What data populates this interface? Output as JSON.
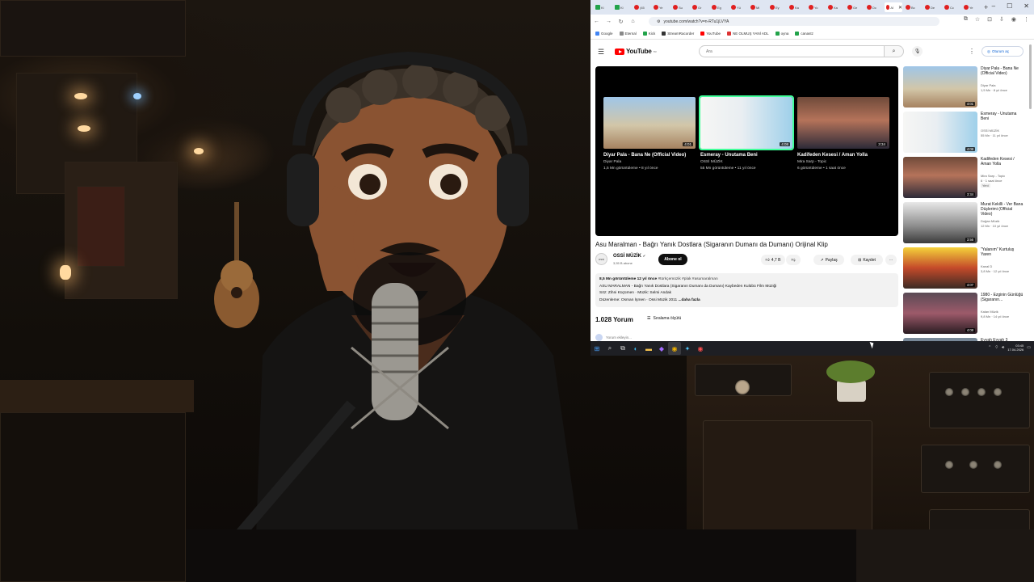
{
  "browser": {
    "tabs": [
      {
        "label": "Ki",
        "favicon": "green"
      },
      {
        "label": "Ki",
        "favicon": "green"
      },
      {
        "label": "(45",
        "favicon": "red"
      },
      {
        "label": "Ye",
        "favicon": "red"
      },
      {
        "label": "Su",
        "favicon": "red"
      },
      {
        "label": "Gr",
        "favicon": "red"
      },
      {
        "label": "Eg",
        "favicon": "red"
      },
      {
        "label": "Yü",
        "favicon": "red"
      },
      {
        "label": "Mi",
        "favicon": "red"
      },
      {
        "label": "Ey",
        "favicon": "red"
      },
      {
        "label": "Ka",
        "favicon": "red"
      },
      {
        "label": "Yo",
        "favicon": "red"
      },
      {
        "label": "Ka",
        "favicon": "red"
      },
      {
        "label": "Ge",
        "favicon": "red"
      },
      {
        "label": "Dc",
        "favicon": "red"
      },
      {
        "label": "Aİ",
        "favicon": "red",
        "active": true
      },
      {
        "label": "Bc",
        "favicon": "red"
      },
      {
        "label": "De",
        "favicon": "red"
      },
      {
        "label": "Cc",
        "favicon": "red"
      },
      {
        "label": "Ye",
        "favicon": "red"
      }
    ],
    "url": "youtube.com/watch?v=n-RTu1jLVYA",
    "bookmarks": [
      "Google",
      "Eternal",
      "Kick",
      "StreamRacorder",
      "YouTube",
      "NE OLMUŞ YANİ ADL",
      "oyna",
      "canastz"
    ]
  },
  "youtube": {
    "logo_text": "YouTube",
    "logo_country": "TR",
    "search_placeholder": "Ara",
    "sign_in_label": "Oturum aç",
    "end_screen": [
      {
        "title": "Diyar Pala - Bana Ne (Official Video)",
        "channel": "Diyar Pala",
        "stats": "1,5 Mn görüntüleme • 8 yıl önce",
        "duration": "4:01"
      },
      {
        "title": "Esmeray - Unutama Beni",
        "channel": "OSSİ MÜZİK",
        "stats": "55 Mn görüntüleme • 11 yıl önce",
        "duration": "4:08"
      },
      {
        "title": "Kadifeden Kesesi / Aman Yolla",
        "channel": "Mira Sarp - Topic",
        "stats": "6 görüntüleme • 1 saat önce",
        "duration": "3:34"
      }
    ],
    "video_title": "Asu Maralman - Bağrı Yanık Dostlara (Sigaranın Dumanı da Dumanı) Orijinal Klip",
    "channel": {
      "name": "OSSİ MÜZİK",
      "subs": "3,55 B abone",
      "avatar_text": "OSSİ"
    },
    "subscribe_label": "Abone ol",
    "likes": "4,7 B",
    "share_label": "Paylaş",
    "save_label": "Kaydet",
    "description": {
      "stats": "8,5 Mn görüntüleme  12 yıl önce",
      "tags": "#türkçemüzik #plak #asumaralman",
      "line1": "ASU MARALMAN - Bağrı Yanık Dostlara (Sigaranın Dumanı da Dumanı) Kaybeden Kulübü Film Müziği",
      "line2": "Söz: Zihni Küçümen · Müzik: Selmi Andak",
      "line3": "Düzenleme: Osman İşmen · Ossi Müzik 2011",
      "more": "...daha fazla"
    },
    "comments_count": "1.028 Yorum",
    "sort_label": "Sıralama ölçütü",
    "add_comment": "Yorum ekleyin...",
    "sidebar": [
      {
        "title": "Diyar Pala - Bana Ne (Official Video)",
        "channel": "Diyar Pala",
        "stats": "1,5 Mn · 8 yıl önce",
        "duration": "4:01"
      },
      {
        "title": "Esmeray - Unutama Beni",
        "channel": "OSSİ MÜZİK",
        "stats": "55 Mn · 11 yıl önce",
        "duration": "4:08"
      },
      {
        "title": "Kadifeden Kesesi / Aman Yolla",
        "channel": "Mira Sarp - Topic",
        "stats": "6 · 1 saat önce",
        "badge": "Yeni",
        "duration": "3:34"
      },
      {
        "title": "Murat Kekilli - Ver Bana Düşlerimi (Official Video)",
        "channel": "Doğan Müzik",
        "stats": "12 Mn · 10 yıl önce",
        "duration": "3:56"
      },
      {
        "title": "\"Yalanım\" Kurtuluş Yaren",
        "channel": "Kanal D",
        "stats": "3,8 Mn · 12 yıl önce",
        "duration": "4:07"
      },
      {
        "title": "1980 - Ezginin Günlüğü (Sigaranın...",
        "channel": "Kalan Müzik",
        "stats": "9,8 Mn · 14 yıl önce",
        "duration": "4:08"
      },
      {
        "title": "Eyvah Eyvah 3",
        "channel": "",
        "stats": "",
        "duration": ""
      }
    ]
  },
  "taskbar": {
    "time": "03:45",
    "date": "17.04.2026"
  }
}
